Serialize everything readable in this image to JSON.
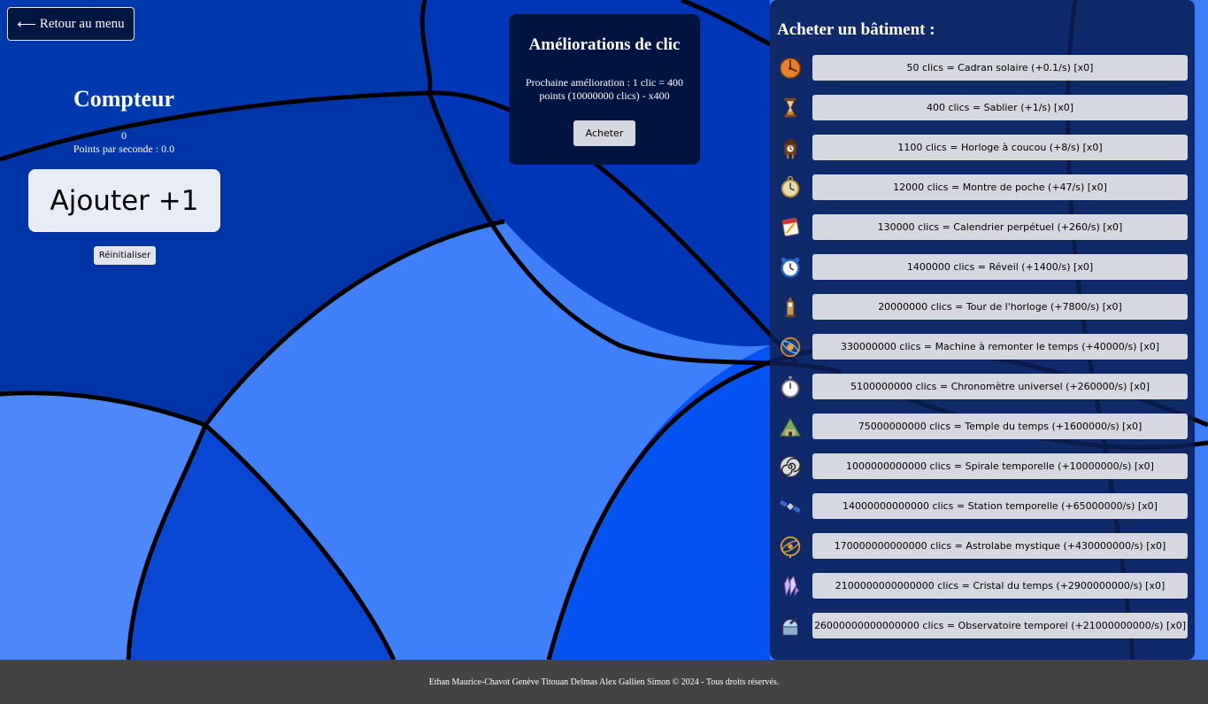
{
  "colors": {
    "background": "#0a3fd0",
    "panel": "#001440",
    "shop_panel": "#0a1e55",
    "footer": "#434343",
    "button": "#d5d8e0"
  },
  "nav": {
    "back_label": "Retour au menu",
    "back_icon": "arrow-left-icon"
  },
  "counter": {
    "title": "Compteur",
    "value": "0",
    "pps": "Points par seconde : 0.0",
    "add_label": "Ajouter +1",
    "reset_label": "Réinitialiser"
  },
  "upgrades": {
    "title": "Améliorations de clic",
    "info": "Prochaine amélioration : 1 clic = 400 points (10000000 clics) - x400",
    "buy_label": "Acheter"
  },
  "shop": {
    "title": "Acheter un bâtiment :",
    "items": [
      {
        "label": "50 clics = Cadran solaire (+0.1/s) [x0]",
        "icon": "sundial-icon"
      },
      {
        "label": "400 clics = Sablier (+1/s) [x0]",
        "icon": "hourglass-icon"
      },
      {
        "label": "1100 clics = Horloge à coucou (+8/s) [x0]",
        "icon": "cuckoo-clock-icon"
      },
      {
        "label": "12000 clics = Montre de poche (+47/s) [x0]",
        "icon": "pocket-watch-icon"
      },
      {
        "label": "130000 clics = Calendrier perpétuel (+260/s) [x0]",
        "icon": "calendar-icon"
      },
      {
        "label": "1400000 clics = Réveil (+1400/s) [x0]",
        "icon": "alarm-clock-icon"
      },
      {
        "label": "20000000 clics = Tour de l'horloge (+7800/s) [x0]",
        "icon": "clock-tower-icon"
      },
      {
        "label": "330000000 clics = Machine à remonter le temps (+40000/s) [x0]",
        "icon": "time-machine-icon"
      },
      {
        "label": "5100000000 clics = Chronomètre universel (+260000/s) [x0]",
        "icon": "stopwatch-icon"
      },
      {
        "label": "75000000000 clics = Temple du temps (+1600000/s) [x0]",
        "icon": "temple-icon"
      },
      {
        "label": "1000000000000 clics = Spirale temporelle (+10000000/s) [x0]",
        "icon": "spiral-icon"
      },
      {
        "label": "14000000000000 clics = Station temporelle (+65000000/s) [x0]",
        "icon": "satellite-icon"
      },
      {
        "label": "170000000000000 clics = Astrolabe mystique (+430000000/s) [x0]",
        "icon": "astrolabe-icon"
      },
      {
        "label": "2100000000000000 clics = Cristal du temps (+2900000000/s) [x0]",
        "icon": "crystal-icon"
      },
      {
        "label": "26000000000000000 clics = Observatoire temporel (+21000000000/s) [x0]",
        "icon": "observatory-icon"
      }
    ]
  },
  "footer": {
    "text": "Ethan Maurice-Chavot Genève Titouan Delmas Alex Gallien Simon © 2024 - Tous droits réservés."
  }
}
